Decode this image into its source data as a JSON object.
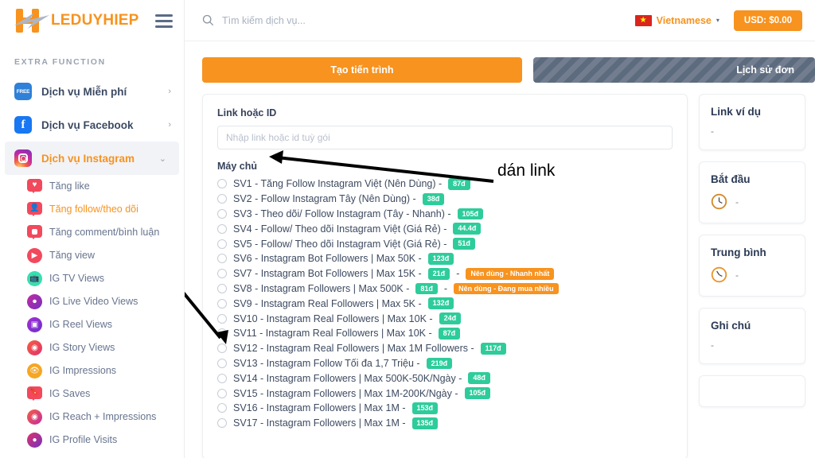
{
  "brand": {
    "name": "LEDUYHIEP",
    "menu_icon": "hamburger-icon"
  },
  "sidebar": {
    "section_label": "EXTRA FUNCTION",
    "top_items": [
      {
        "label": "Dịch vụ Miễn phí",
        "icon": "free-badge-icon",
        "icon_text": "FREE",
        "chevron": "›",
        "active": false
      },
      {
        "label": "Dịch vụ Facebook",
        "icon": "facebook-icon",
        "icon_text": "f",
        "chevron": "›",
        "active": false
      },
      {
        "label": "Dịch vụ Instagram",
        "icon": "instagram-icon",
        "icon_text": "",
        "chevron": "⌄",
        "active": true
      }
    ],
    "sub_items": [
      {
        "label": "Tăng like",
        "icon": "heart-icon",
        "active": false
      },
      {
        "label": "Tăng follow/theo dõi",
        "icon": "user-follow-icon",
        "active": true
      },
      {
        "label": "Tăng comment/bình luận",
        "icon": "comment-icon",
        "active": false
      },
      {
        "label": "Tăng view",
        "icon": "play-icon",
        "active": false
      },
      {
        "label": "IG TV Views",
        "icon": "igtv-icon",
        "active": false
      },
      {
        "label": "IG Live Video Views",
        "icon": "live-video-icon",
        "active": false
      },
      {
        "label": "IG Reel Views",
        "icon": "reel-icon",
        "active": false
      },
      {
        "label": "IG Story Views",
        "icon": "story-icon",
        "active": false
      },
      {
        "label": "IG Impressions",
        "icon": "eye-icon",
        "active": false
      },
      {
        "label": "IG Saves",
        "icon": "bookmark-icon",
        "active": false
      },
      {
        "label": "IG Reach + Impressions",
        "icon": "reach-icon",
        "active": false
      },
      {
        "label": "IG Profile Visits",
        "icon": "profile-visit-icon",
        "active": false
      }
    ]
  },
  "topbar": {
    "search_icon": "search-icon",
    "search_placeholder": "Tìm kiếm dịch vụ...",
    "search_value": "",
    "language": "Vietnamese",
    "language_caret": "▾",
    "flag_icon": "vietnam-flag-icon",
    "balance": "USD: $0.00"
  },
  "tabs": {
    "create": "Tạo tiến trình",
    "history": "Lịch sử đơn"
  },
  "form": {
    "link_label": "Link hoặc ID",
    "link_placeholder": "Nhập link hoặc id tuỳ gói",
    "link_value": "",
    "server_label": "Máy chủ",
    "options": [
      {
        "text": "SV1 - Tăng Follow Instagram Việt (Nên Dùng) -",
        "price": "87đ",
        "tag": ""
      },
      {
        "text": "SV2 - Follow Instagram Tây (Nên Dùng) -",
        "price": "38đ",
        "tag": ""
      },
      {
        "text": "SV3 - Theo dõi/ Follow Instagram (Tây - Nhanh) -",
        "price": "105đ",
        "tag": ""
      },
      {
        "text": "SV4 - Follow/ Theo dõi Instagram Việt (Giá Rẻ) -",
        "price": "44.4đ",
        "tag": ""
      },
      {
        "text": "SV5 - Follow/ Theo dõi Instagram Việt (Giá Rẻ) -",
        "price": "51đ",
        "tag": ""
      },
      {
        "text": "SV6 - Instagram Bot Followers | Max 50K -",
        "price": "123đ",
        "tag": ""
      },
      {
        "text": "SV7 - Instagram Bot Followers | Max 15K -",
        "price": "21đ",
        "tag": "Nên dùng - Nhanh nhất"
      },
      {
        "text": "SV8 - Instagram Followers | Max 500K -",
        "price": "81đ",
        "tag": "Nên dùng - Đang mua nhiều"
      },
      {
        "text": "SV9 - Instagram Real Followers | Max 5K -",
        "price": "132đ",
        "tag": ""
      },
      {
        "text": "SV10 - Instagram Real Followers | Max 10K -",
        "price": "24đ",
        "tag": ""
      },
      {
        "text": "SV11 - Instagram Real Followers | Max 10K -",
        "price": "87đ",
        "tag": ""
      },
      {
        "text": "SV12 - Instagram Real Followers | Max 1M Followers -",
        "price": "117đ",
        "tag": ""
      },
      {
        "text": "SV13 - Instagram Follow Tối đa 1,7 Triệu -",
        "price": "219đ",
        "tag": ""
      },
      {
        "text": "SV14 - Instagram Followers | Max 500K-50K/Ngày -",
        "price": "48đ",
        "tag": ""
      },
      {
        "text": "SV15 - Instagram Followers | Max 1M-200K/Ngày -",
        "price": "105đ",
        "tag": ""
      },
      {
        "text": "SV16 - Instagram Followers | Max 1M -",
        "price": "153đ",
        "tag": ""
      },
      {
        "text": "SV17 - Instagram Followers | Max 1M -",
        "price": "135đ",
        "tag": ""
      }
    ]
  },
  "rail": [
    {
      "title": "Link ví dụ",
      "value": "-",
      "icon": ""
    },
    {
      "title": "Bắt đầu",
      "value": "-",
      "icon": "clock-icon"
    },
    {
      "title": "Trung bình",
      "value": "-",
      "icon": "clock-icon"
    },
    {
      "title": "Ghi chú",
      "value": "-",
      "icon": ""
    }
  ],
  "annotations": {
    "paste_link_text": "dán link",
    "arrow_1": "arrow-to-link-input",
    "arrow_2": "arrow-to-server-list"
  },
  "colors": {
    "accent_orange": "#f7931e",
    "green_pill": "#2ecc9b",
    "dark_slate": "#5d6b7f",
    "text_dark": "#36415a"
  }
}
